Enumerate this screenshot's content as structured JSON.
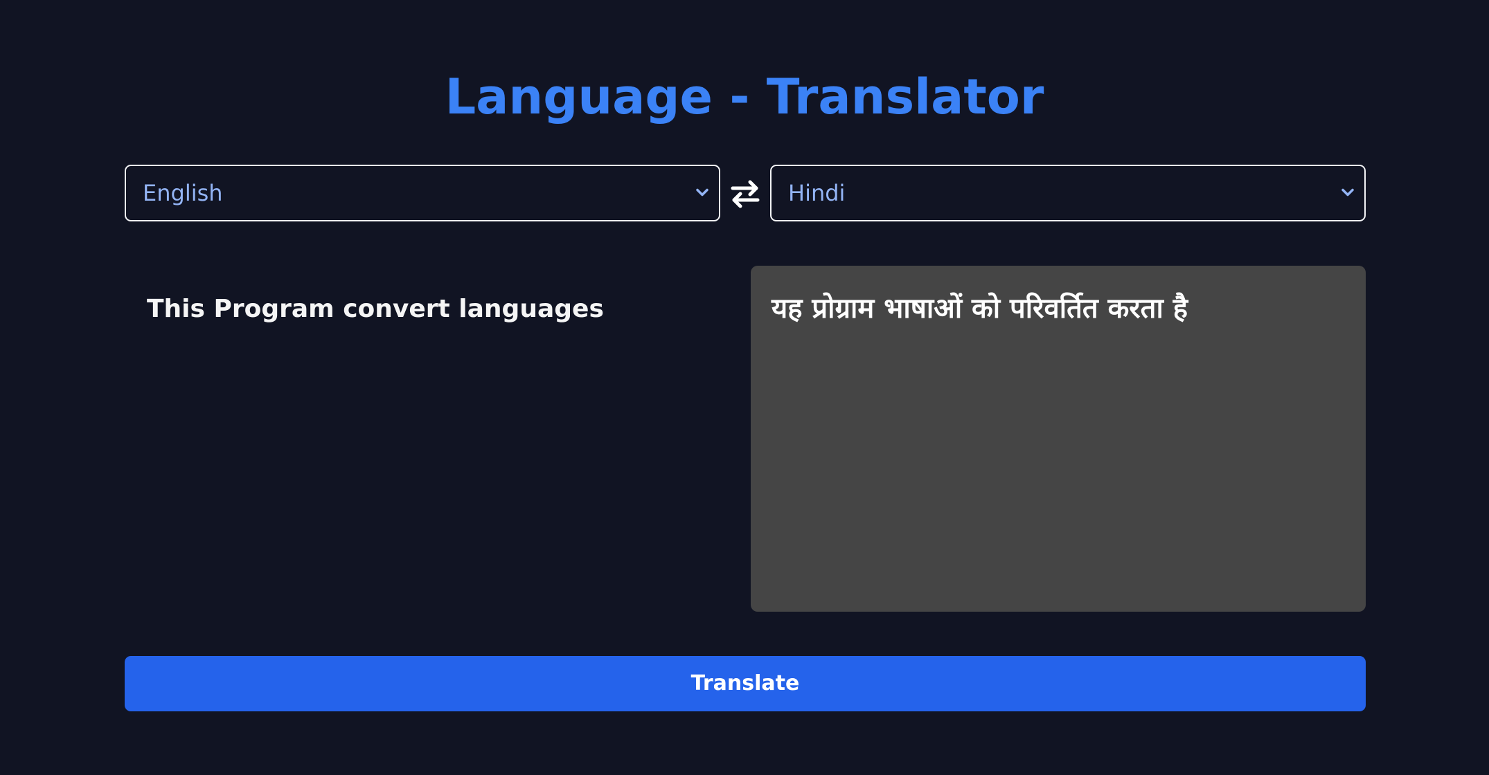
{
  "header": {
    "title": "Language - Translator"
  },
  "languages": {
    "source": {
      "selected": "English",
      "icon": "chevron-down-icon"
    },
    "swap_icon": "swap-arrows-icon",
    "target": {
      "selected": "Hindi",
      "icon": "chevron-down-icon"
    }
  },
  "input": {
    "value": "This Program convert languages"
  },
  "output": {
    "value": "यह प्रोग्राम भाषाओं को परिवर्तित करता है"
  },
  "actions": {
    "translate_label": "Translate"
  },
  "colors": {
    "background": "#111423",
    "title": "#3b82f6",
    "select_text": "#93b4f5",
    "output_background": "#454545",
    "button": "#2563eb"
  }
}
